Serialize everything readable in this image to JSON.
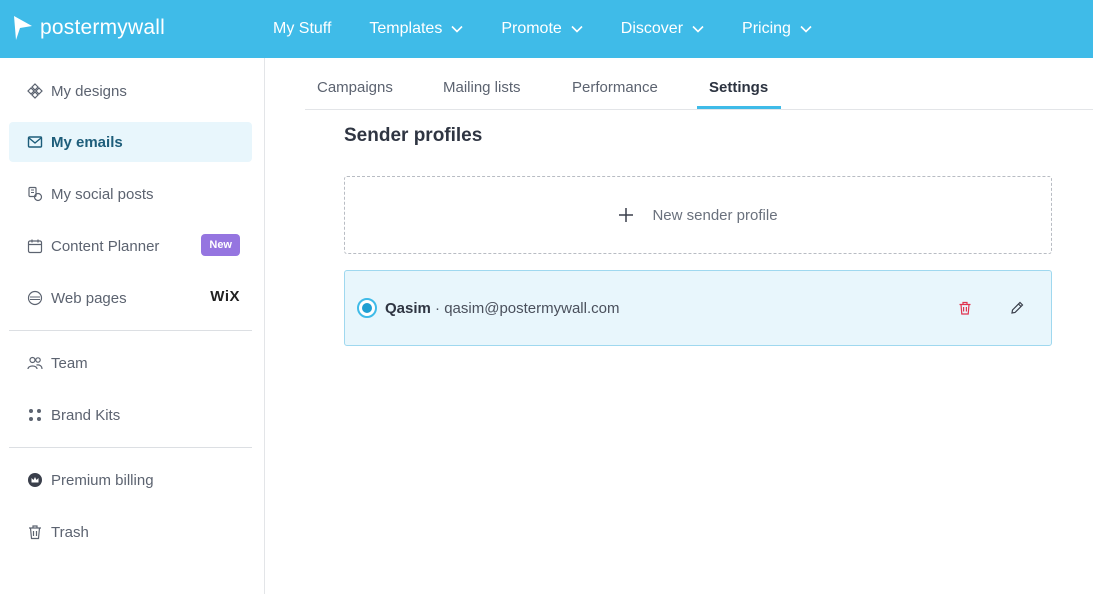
{
  "app": {
    "logo_text": "postermywall"
  },
  "topnav": {
    "items": [
      {
        "label": "My Stuff",
        "has_chevron": false
      },
      {
        "label": "Templates",
        "has_chevron": true
      },
      {
        "label": "Promote",
        "has_chevron": true
      },
      {
        "label": "Discover",
        "has_chevron": true
      },
      {
        "label": "Pricing",
        "has_chevron": true
      }
    ]
  },
  "sidebar": {
    "items": [
      {
        "label": "My designs",
        "icon": "designs-icon"
      },
      {
        "label": "My emails",
        "icon": "mail-icon",
        "active": true
      },
      {
        "label": "My social posts",
        "icon": "social-posts-icon"
      },
      {
        "label": "Content Planner",
        "icon": "calendar-icon",
        "badge": "New"
      },
      {
        "label": "Web pages",
        "icon": "web-icon",
        "partner": "WiX"
      },
      {
        "label": "Team",
        "icon": "team-icon"
      },
      {
        "label": "Brand Kits",
        "icon": "brand-kits-icon"
      },
      {
        "label": "Premium billing",
        "icon": "crown-icon"
      },
      {
        "label": "Trash",
        "icon": "trash-icon"
      }
    ]
  },
  "tabs": [
    {
      "label": "Campaigns"
    },
    {
      "label": "Mailing lists"
    },
    {
      "label": "Performance"
    },
    {
      "label": "Settings",
      "active": true
    }
  ],
  "main": {
    "section_title": "Sender profiles",
    "new_profile_label": "New sender profile",
    "profiles": [
      {
        "name": "Qasim",
        "separator": " · ",
        "email": "qasim@postermywall.com",
        "selected": true
      }
    ]
  },
  "colors": {
    "brand": "#3fbbe8",
    "active_bg": "#e8f6fc",
    "badge": "#9575e0",
    "delete": "#e0334f"
  }
}
